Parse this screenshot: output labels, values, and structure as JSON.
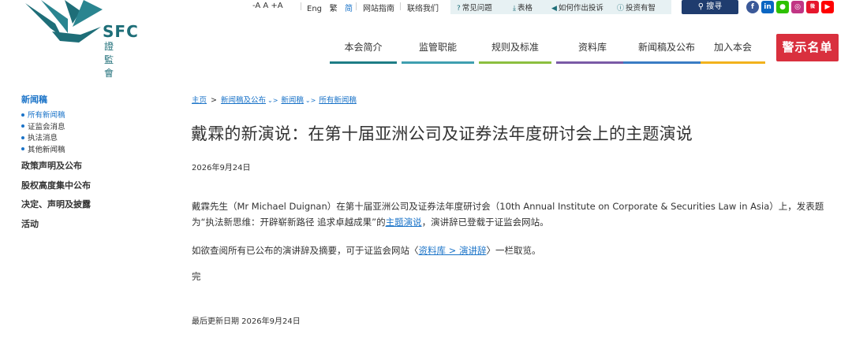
{
  "logo": {
    "abbr": "SFC",
    "chinese": "證監會",
    "colors": {
      "primary": "#1e6e78"
    }
  },
  "topbar": {
    "font_sizes": "-A  A  +A",
    "lang": {
      "eng": "Eng",
      "trad": "繁",
      "simp": "简"
    },
    "site_guide": "网站指南",
    "contact": "联络我们",
    "quick_links": [
      {
        "icon": "question-icon",
        "label": "常见问题"
      },
      {
        "icon": "download-icon",
        "label": "表格"
      },
      {
        "icon": "megaphone-icon",
        "label": "如何作出投诉"
      },
      {
        "icon": "info-icon",
        "label": "投资有智"
      }
    ],
    "search_label": "搜寻",
    "social": [
      "facebook",
      "linkedin",
      "wechat",
      "instagram",
      "weibo",
      "youtube"
    ]
  },
  "nav": {
    "items": [
      {
        "label": "本会简介",
        "color": "#1e7d86"
      },
      {
        "label": "监管职能",
        "color": "#3f9fb0"
      },
      {
        "label": "规则及标准",
        "color": "#8cbf3f"
      },
      {
        "label": "资料库",
        "color": "#7a5aa6"
      },
      {
        "label": "新闻稿及公布",
        "color": "#3a7cc4"
      },
      {
        "label": "加入本会",
        "color": "#f2b21c"
      }
    ],
    "alert_label": "警示名单",
    "alert_color": "#d9303e"
  },
  "sidebar": {
    "heading": "新闻稿",
    "sub_items": [
      {
        "label": "所有新闻稿",
        "active": true
      },
      {
        "label": "证监会消息",
        "active": false
      },
      {
        "label": "执法消息",
        "active": false
      },
      {
        "label": "其他新闻稿",
        "active": false
      }
    ],
    "top_items": [
      "政策声明及公布",
      "股权高度集中公布",
      "决定、声明及披露",
      "活动"
    ]
  },
  "breadcrumb": {
    "home": "主页",
    "level1": "新闻稿及公布",
    "level2": "新闻稿",
    "level3": "所有新闻稿"
  },
  "article": {
    "title": "戴霖的新演说：在第十届亚洲公司及证券法年度研讨会上的主题演说",
    "date": "2026年9月24日",
    "p1_before": "戴霖先生（Mr Michael Duignan）在第十届亚洲公司及证券法年度研讨会（10th Annual Institute on Corporate & Securities Law in Asia）上，发表题为“执法新思维：开辟崭新路径 追求卓越成果”的",
    "p1_link": "主题演说",
    "p1_after": "，演讲辞已登载于证监会网站。",
    "p2_before": "如欲查阅所有已公布的演讲辞及摘要，可于证监会网站〈",
    "p2_link": "资料库 > 演讲辞",
    "p2_after": "〉一栏取览。",
    "end_mark": "完",
    "last_updated": "最后更新日期 2026年9月24日"
  }
}
